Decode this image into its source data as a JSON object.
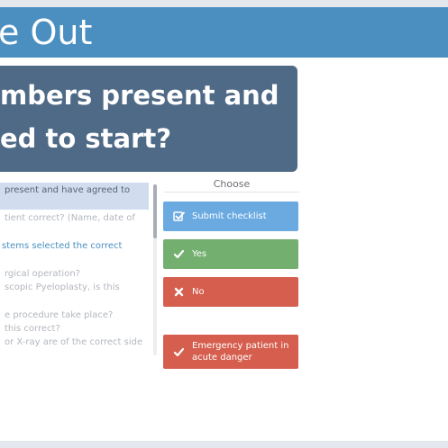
{
  "header": {
    "title": "e Out"
  },
  "question": {
    "line1": "mbers present and",
    "line2": "ed to start?"
  },
  "checklist": {
    "items": [
      {
        "text": "present and have agreed to"
      },
      {
        "text": "tient correct? (Name, date of"
      },
      {
        "text": "stems selected the correct"
      },
      {
        "text": "rgical operation?"
      },
      {
        "text": "scopic Pyeloplasty, is this"
      },
      {
        "text": "e procedure take place?"
      },
      {
        "text": "this correct?"
      },
      {
        "text": "or X-ray are of the correct side"
      }
    ]
  },
  "choose": {
    "label": "Choose"
  },
  "buttons": {
    "submit": "Submit checklist",
    "yes": "Yes",
    "no": "No",
    "emergency": "Emergency patient in acute danger"
  },
  "icons": {
    "submit": "checkbox-icon",
    "yes": "check-icon",
    "no": "close-icon",
    "emergency": "check-icon"
  },
  "colors": {
    "header": "#4a8fc0",
    "question_card": "#4f6a86",
    "submit": "#6aaae0",
    "yes": "#73b06f",
    "no": "#d55e4e",
    "emergency": "#d55e4e"
  }
}
